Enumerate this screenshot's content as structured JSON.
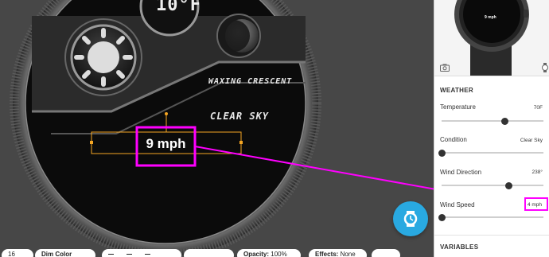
{
  "watch_face": {
    "temperature": "10°F",
    "moon_phase": "WAXING CRESCENT",
    "condition": "CLEAR SKY",
    "wind_speed": "9 mph"
  },
  "toolbar": {
    "size_value": "16",
    "dim_color_label": "Dim Color",
    "opacity_label": "Opacity:",
    "opacity_value": "100%",
    "effects_label": "Effects:",
    "effects_value": "None"
  },
  "panel": {
    "preview": {
      "wind_speed": "9 mph"
    },
    "weather_title": "WEATHER",
    "rows": [
      {
        "label": "Temperature",
        "value": "70F",
        "level": 0.62
      },
      {
        "label": "Condition",
        "value": "Clear Sky",
        "level": 0.0
      },
      {
        "label": "Wind Direction",
        "value": "238°",
        "level": 0.66
      },
      {
        "label": "Wind Speed",
        "value": "4 mph",
        "level": 0.0
      }
    ],
    "variables_title": "VARIABLES"
  },
  "colors": {
    "annotation": "#ff00ff",
    "selection": "#f5a623",
    "fab": "#29a9e1"
  }
}
